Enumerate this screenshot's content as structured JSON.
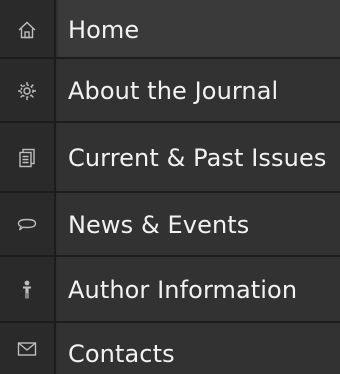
{
  "menu": {
    "items": [
      {
        "label": "Home",
        "icon": "home-icon"
      },
      {
        "label": "About the Journal",
        "icon": "gear-icon"
      },
      {
        "label": "Current & Past Issues",
        "icon": "documents-icon"
      },
      {
        "label": "News & Events",
        "icon": "speech-bubble-icon"
      },
      {
        "label": "Author Information",
        "icon": "person-icon"
      },
      {
        "label": "Contacts",
        "icon": "envelope-icon"
      }
    ]
  },
  "colors": {
    "background": "#303030",
    "icon_column": "#2a2a2a",
    "separator": "#1c1c1c",
    "text": "#f2f2f2",
    "icon": "#bdbdbd"
  }
}
